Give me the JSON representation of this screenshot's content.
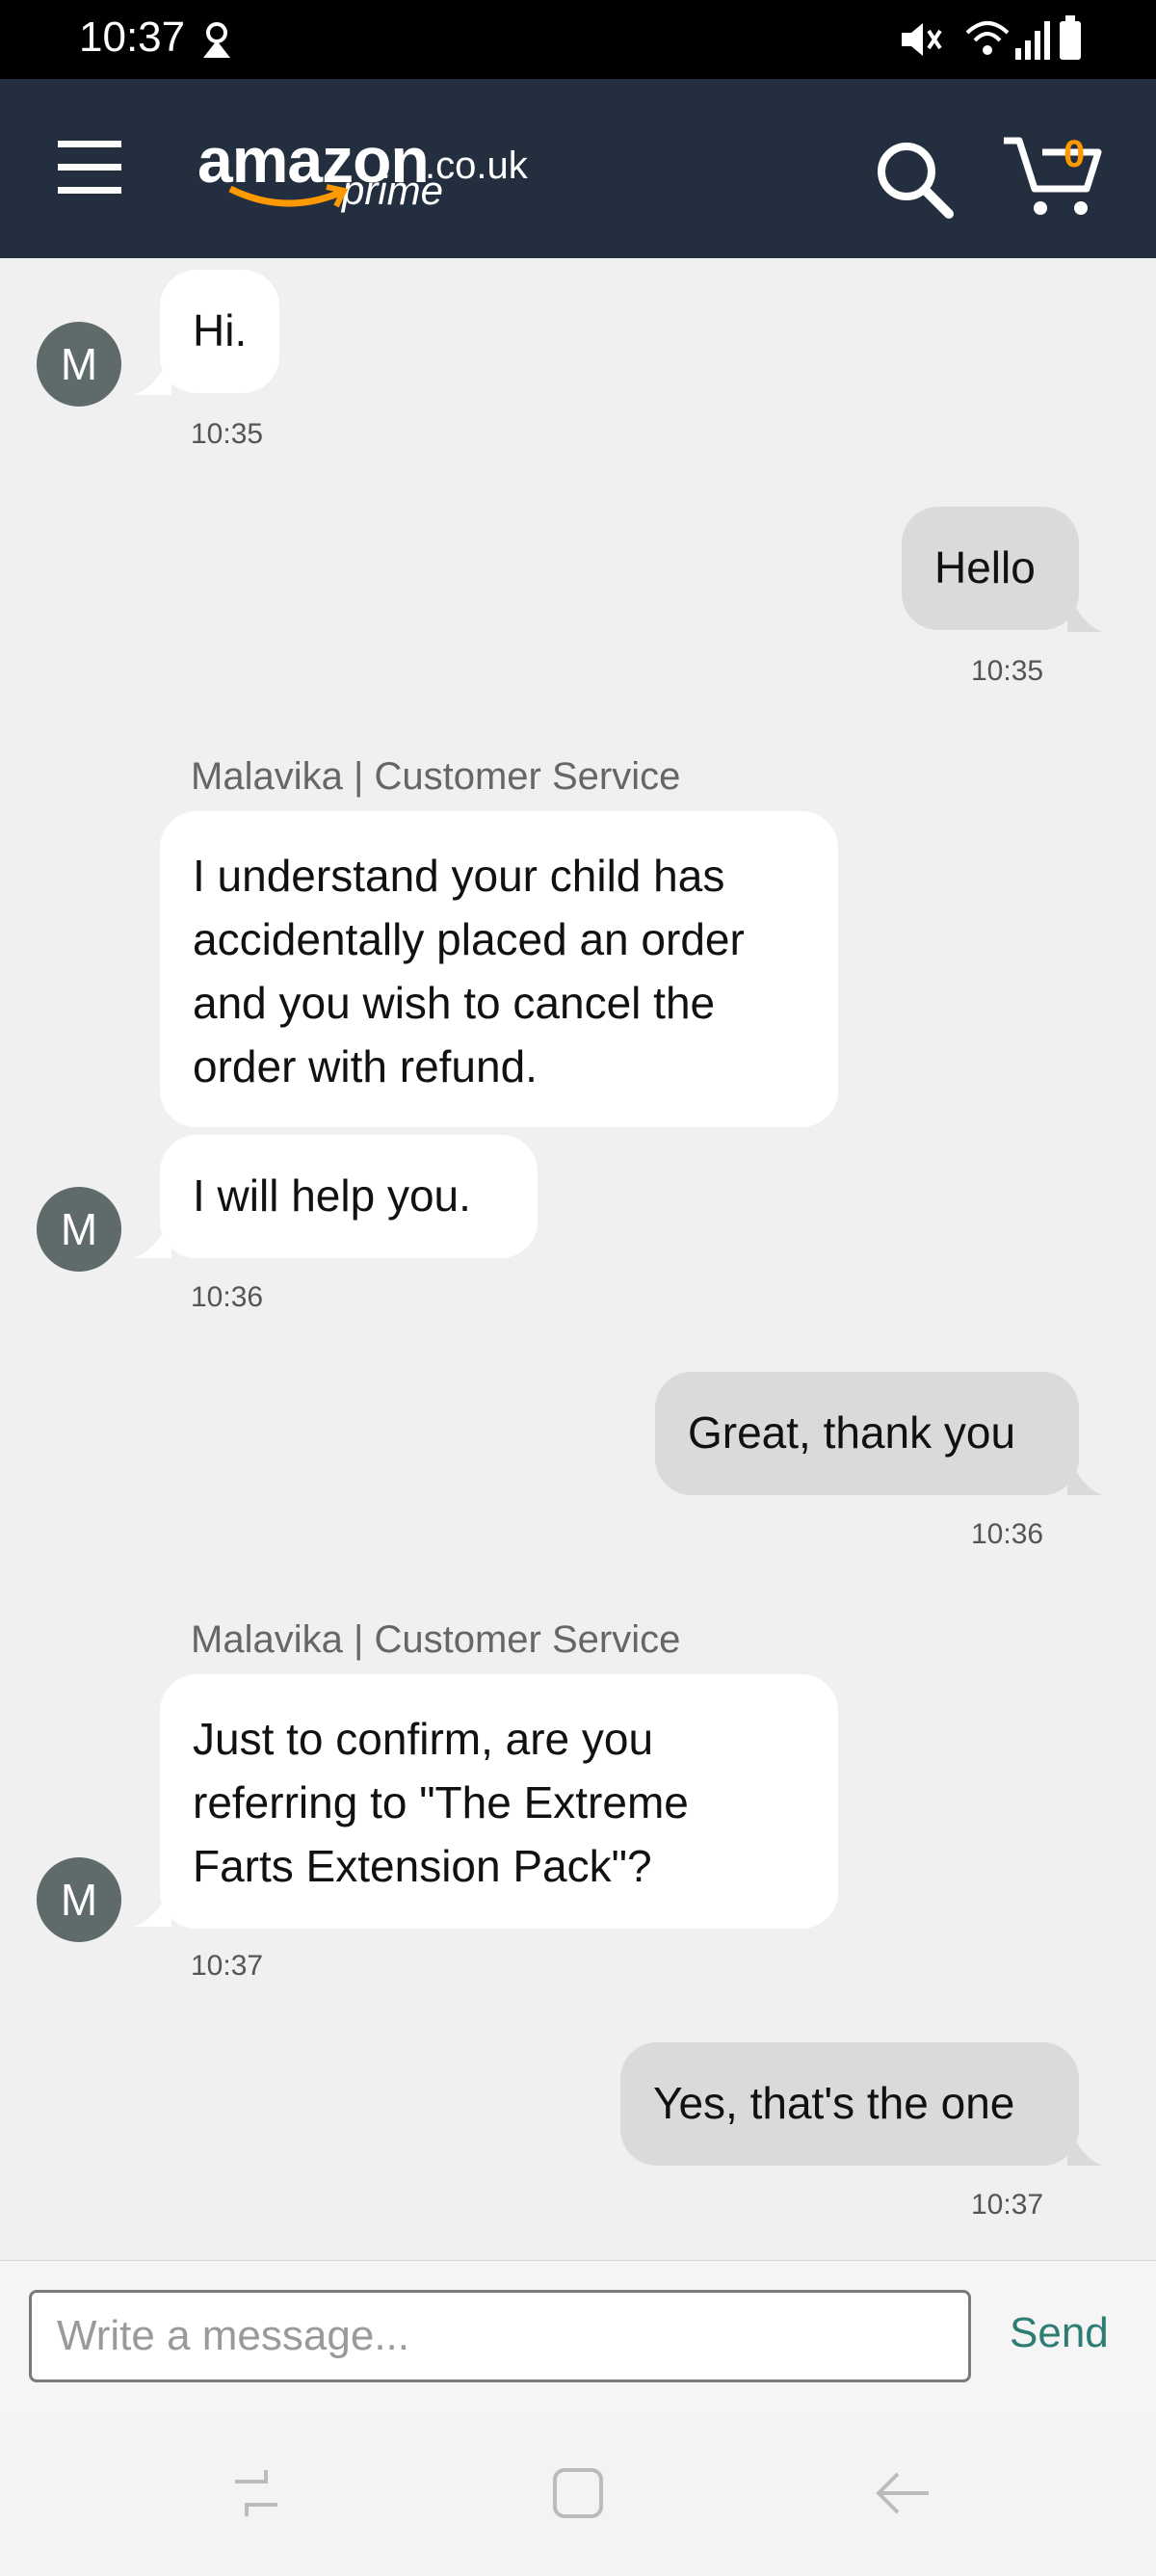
{
  "status_bar": {
    "time": "10:37"
  },
  "header": {
    "logo_word": "amazon",
    "logo_tld": ".co.uk",
    "logo_sub": "prime",
    "cart_count": "0"
  },
  "avatar_letter": "M",
  "messages": [
    {
      "text": "Hi.",
      "time": "10:35"
    },
    {
      "text": "Hello",
      "time": "10:35"
    },
    {
      "sender": "Malavika | Customer Service",
      "lines": [
        "I understand your child has",
        "accidentally placed an order",
        "and you wish to cancel the",
        "order with refund."
      ]
    },
    {
      "text": "I will help you.",
      "time": "10:36"
    },
    {
      "text": "Great, thank you",
      "time": "10:36"
    },
    {
      "sender": "Malavika | Customer Service",
      "lines": [
        "Just to confirm, are you",
        "referring to \"The Extreme",
        "Farts Extension Pack\"?"
      ],
      "time": "10:37"
    },
    {
      "text": "Yes, that's the one",
      "time": "10:37"
    }
  ],
  "composer": {
    "placeholder": "Write a message...",
    "send_label": "Send"
  },
  "colors": {
    "header_bg": "#232f3e",
    "smile": "#f90",
    "send": "#2e7d74"
  }
}
